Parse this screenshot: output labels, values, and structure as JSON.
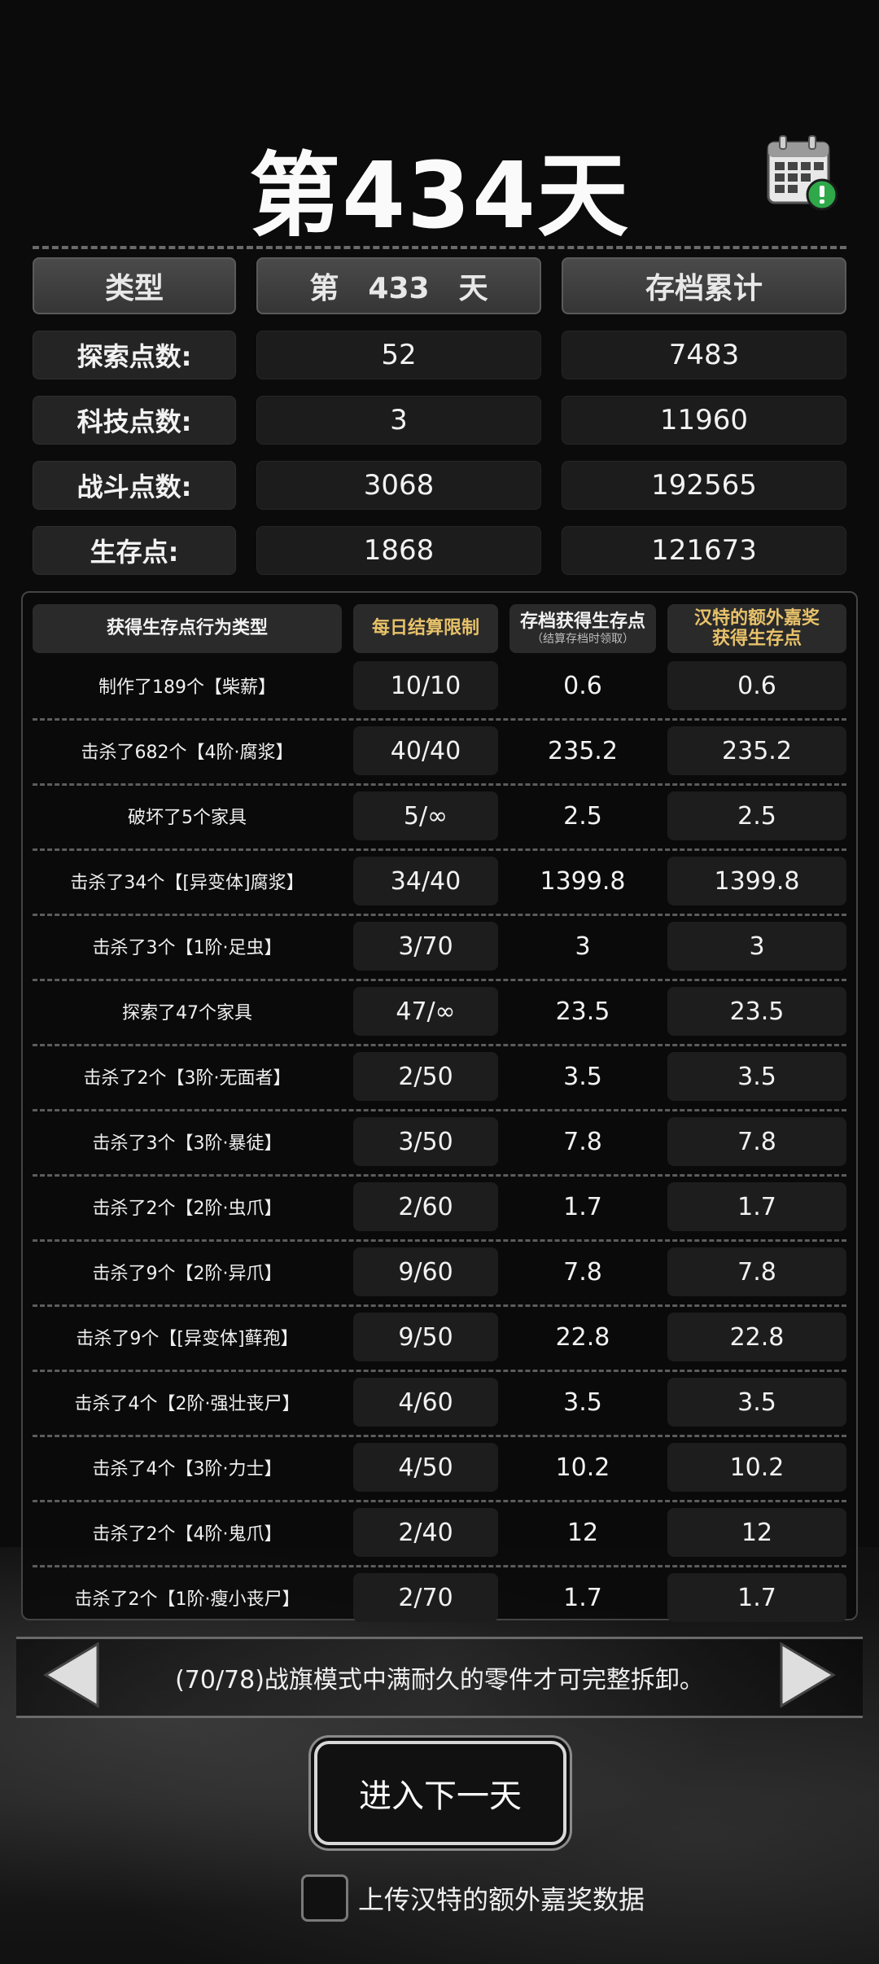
{
  "header": {
    "title": "第434天",
    "calendar_icon": "calendar-alert-icon"
  },
  "summary": {
    "columns": [
      "类型",
      "第　433　天",
      "存档累计"
    ],
    "rows": [
      {
        "label": "探索点数:",
        "day": "52",
        "total": "7483"
      },
      {
        "label": "科技点数:",
        "day": "3",
        "total": "11960"
      },
      {
        "label": "战斗点数:",
        "day": "3068",
        "total": "192565"
      },
      {
        "label": "生存点:",
        "day": "1868",
        "total": "121673"
      }
    ]
  },
  "detail": {
    "headers": {
      "type": "获得生存点行为类型",
      "limit": "每日结算限制",
      "save_points": "存档获得生存点",
      "save_points_note": "（结算存档时领取）",
      "bonus_line1": "汉特的额外嘉奖",
      "bonus_line2": "获得生存点"
    },
    "rows": [
      {
        "action": "制作了189个【柴薪】",
        "limit": "10/10",
        "points": "0.6",
        "bonus": "0.6"
      },
      {
        "action": "击杀了682个【4阶·腐浆】",
        "limit": "40/40",
        "points": "235.2",
        "bonus": "235.2"
      },
      {
        "action": "破坏了5个家具",
        "limit": "5/∞",
        "points": "2.5",
        "bonus": "2.5"
      },
      {
        "action": "击杀了34个【[异变体]腐浆】",
        "limit": "34/40",
        "points": "1399.8",
        "bonus": "1399.8"
      },
      {
        "action": "击杀了3个【1阶·足虫】",
        "limit": "3/70",
        "points": "3",
        "bonus": "3"
      },
      {
        "action": "探索了47个家具",
        "limit": "47/∞",
        "points": "23.5",
        "bonus": "23.5"
      },
      {
        "action": "击杀了2个【3阶·无面者】",
        "limit": "2/50",
        "points": "3.5",
        "bonus": "3.5"
      },
      {
        "action": "击杀了3个【3阶·暴徒】",
        "limit": "3/50",
        "points": "7.8",
        "bonus": "7.8"
      },
      {
        "action": "击杀了2个【2阶·虫爪】",
        "limit": "2/60",
        "points": "1.7",
        "bonus": "1.7"
      },
      {
        "action": "击杀了9个【2阶·异爪】",
        "limit": "9/60",
        "points": "7.8",
        "bonus": "7.8"
      },
      {
        "action": "击杀了9个【[异变体]藓孢】",
        "limit": "9/50",
        "points": "22.8",
        "bonus": "22.8"
      },
      {
        "action": "击杀了4个【2阶·强壮丧尸】",
        "limit": "4/60",
        "points": "3.5",
        "bonus": "3.5"
      },
      {
        "action": "击杀了4个【3阶·力士】",
        "limit": "4/50",
        "points": "10.2",
        "bonus": "10.2"
      },
      {
        "action": "击杀了2个【4阶·鬼爪】",
        "limit": "2/40",
        "points": "12",
        "bonus": "12"
      },
      {
        "action": "击杀了2个【1阶·瘦小丧尸】",
        "limit": "2/70",
        "points": "1.7",
        "bonus": "1.7"
      }
    ]
  },
  "tip": {
    "text": "(70/78)战旗模式中满耐久的零件才可完整拆卸。",
    "prev_icon": "triangle-left-icon",
    "next_icon": "triangle-right-icon"
  },
  "next_day_button": "进入下一天",
  "upload_checkbox": {
    "label": "上传汉特的额外嘉奖数据",
    "checked": false
  },
  "colors": {
    "gold_header": "#e8c26a",
    "background": "#0b0b0b"
  }
}
